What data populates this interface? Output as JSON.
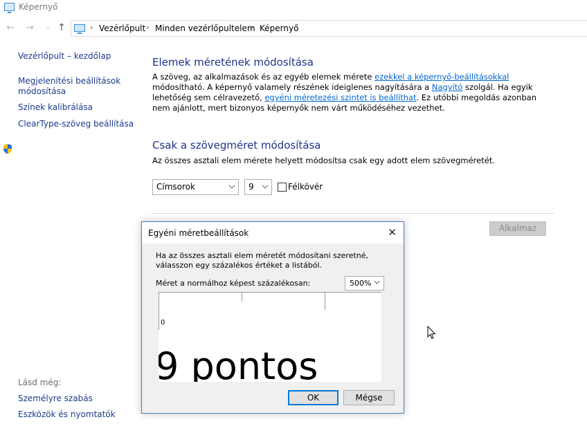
{
  "window": {
    "title": "Képernyő"
  },
  "breadcrumb": [
    "Vezérlőpult",
    "Minden vezérlőpultelem",
    "Képernyő"
  ],
  "sidebar": {
    "home": "Vezérlőpult – kezdőlap",
    "items": [
      "Megjelenítési beállítások",
      "módosítása",
      "Színek kalibrálása",
      "ClearType-szöveg beállítása"
    ],
    "see_also_title": "Lásd még:",
    "see_also": [
      "Személyre szabás",
      "Eszközök és nyomtatók"
    ]
  },
  "main": {
    "section1_title": "Elemek méretének módosítása",
    "section1_text": {
      "t1": "A szöveg, az alkalmazások és az egyéb elemek mérete ",
      "link1": "ezekkel a képernyő-beállításokkal",
      "t2": " módosítható. A képernyő valamely részének ideiglenes nagyítására a ",
      "link2": "Nagyító",
      "t3": " szolgál. Ha egyik lehetőség sem célravezető, ",
      "link3": "egyéni méretezési szintet is beállíthat",
      "t4": ". Ez utóbbi megoldás azonban nem ajánlott, mert bizonyos képernyők nem várt működéséhez vezethet."
    },
    "section2_title": "Csak a szövegméret módosítása",
    "section2_text": "Az összes asztali elem mérete helyett módosítsa csak egy adott elem szövegméretét.",
    "element_select": "Címsorok",
    "size_select": "9",
    "bold_label": "Félkövér",
    "bold_checked": false,
    "apply_button": "Alkalmaz"
  },
  "dialog": {
    "title": "Egyéni méretbeállítások",
    "text": "Ha az összes asztali elem méretét módosítani szeretné, válasszon egy százalékos értéket a listából.",
    "scale_label": "Méret a normálhoz képest százalékosan:",
    "scale_value": "500%",
    "ruler_zero": "0",
    "sample_text": "9 pontos",
    "ok_button": "OK",
    "cancel_button": "Mégse"
  }
}
